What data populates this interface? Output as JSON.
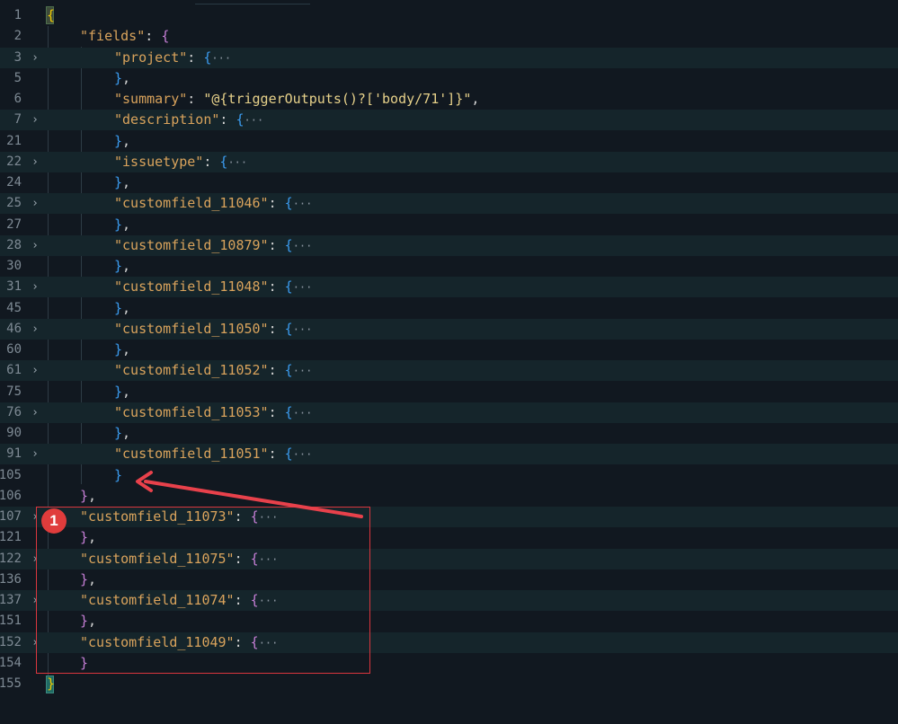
{
  "editor": {
    "lines": [
      {
        "num": "1",
        "fold": false,
        "indent": 0,
        "parts": [
          {
            "t": "{",
            "c": "brace-y"
          }
        ]
      },
      {
        "num": "2",
        "fold": false,
        "indent": 1,
        "parts": [
          {
            "t": "\"fields\"",
            "c": "key"
          },
          {
            "t": ": ",
            "c": "punc"
          },
          {
            "t": "{",
            "c": "brace-m"
          }
        ]
      },
      {
        "num": "3",
        "fold": true,
        "indent": 2,
        "parts": [
          {
            "t": "\"project\"",
            "c": "key"
          },
          {
            "t": ": ",
            "c": "punc"
          },
          {
            "t": "{",
            "c": "brace-b"
          },
          {
            "t": "···",
            "c": "ell"
          }
        ]
      },
      {
        "num": "5",
        "fold": false,
        "indent": 2,
        "parts": [
          {
            "t": "}",
            "c": "brace-b"
          },
          {
            "t": ",",
            "c": "punc"
          }
        ]
      },
      {
        "num": "6",
        "fold": false,
        "indent": 2,
        "parts": [
          {
            "t": "\"summary\"",
            "c": "key"
          },
          {
            "t": ": ",
            "c": "punc"
          },
          {
            "t": "\"@{triggerOutputs()?['body/71']}\"",
            "c": "str"
          },
          {
            "t": ",",
            "c": "punc"
          }
        ]
      },
      {
        "num": "7",
        "fold": true,
        "indent": 2,
        "parts": [
          {
            "t": "\"description\"",
            "c": "key"
          },
          {
            "t": ": ",
            "c": "punc"
          },
          {
            "t": "{",
            "c": "brace-b"
          },
          {
            "t": "···",
            "c": "ell"
          }
        ]
      },
      {
        "num": "21",
        "fold": false,
        "indent": 2,
        "parts": [
          {
            "t": "}",
            "c": "brace-b"
          },
          {
            "t": ",",
            "c": "punc"
          }
        ]
      },
      {
        "num": "22",
        "fold": true,
        "indent": 2,
        "parts": [
          {
            "t": "\"issuetype\"",
            "c": "key"
          },
          {
            "t": ": ",
            "c": "punc"
          },
          {
            "t": "{",
            "c": "brace-b"
          },
          {
            "t": "···",
            "c": "ell"
          }
        ]
      },
      {
        "num": "24",
        "fold": false,
        "indent": 2,
        "parts": [
          {
            "t": "}",
            "c": "brace-b"
          },
          {
            "t": ",",
            "c": "punc"
          }
        ]
      },
      {
        "num": "25",
        "fold": true,
        "indent": 2,
        "parts": [
          {
            "t": "\"customfield_11046\"",
            "c": "key"
          },
          {
            "t": ": ",
            "c": "punc"
          },
          {
            "t": "{",
            "c": "brace-b"
          },
          {
            "t": "···",
            "c": "ell"
          }
        ]
      },
      {
        "num": "27",
        "fold": false,
        "indent": 2,
        "parts": [
          {
            "t": "}",
            "c": "brace-b"
          },
          {
            "t": ",",
            "c": "punc"
          }
        ]
      },
      {
        "num": "28",
        "fold": true,
        "indent": 2,
        "parts": [
          {
            "t": "\"customfield_10879\"",
            "c": "key"
          },
          {
            "t": ": ",
            "c": "punc"
          },
          {
            "t": "{",
            "c": "brace-b"
          },
          {
            "t": "···",
            "c": "ell"
          }
        ]
      },
      {
        "num": "30",
        "fold": false,
        "indent": 2,
        "parts": [
          {
            "t": "}",
            "c": "brace-b"
          },
          {
            "t": ",",
            "c": "punc"
          }
        ]
      },
      {
        "num": "31",
        "fold": true,
        "indent": 2,
        "parts": [
          {
            "t": "\"customfield_11048\"",
            "c": "key"
          },
          {
            "t": ": ",
            "c": "punc"
          },
          {
            "t": "{",
            "c": "brace-b"
          },
          {
            "t": "···",
            "c": "ell"
          }
        ]
      },
      {
        "num": "45",
        "fold": false,
        "indent": 2,
        "parts": [
          {
            "t": "}",
            "c": "brace-b"
          },
          {
            "t": ",",
            "c": "punc"
          }
        ]
      },
      {
        "num": "46",
        "fold": true,
        "indent": 2,
        "parts": [
          {
            "t": "\"customfield_11050\"",
            "c": "key"
          },
          {
            "t": ": ",
            "c": "punc"
          },
          {
            "t": "{",
            "c": "brace-b"
          },
          {
            "t": "···",
            "c": "ell"
          }
        ]
      },
      {
        "num": "60",
        "fold": false,
        "indent": 2,
        "parts": [
          {
            "t": "}",
            "c": "brace-b"
          },
          {
            "t": ",",
            "c": "punc"
          }
        ]
      },
      {
        "num": "61",
        "fold": true,
        "indent": 2,
        "parts": [
          {
            "t": "\"customfield_11052\"",
            "c": "key"
          },
          {
            "t": ": ",
            "c": "punc"
          },
          {
            "t": "{",
            "c": "brace-b"
          },
          {
            "t": "···",
            "c": "ell"
          }
        ]
      },
      {
        "num": "75",
        "fold": false,
        "indent": 2,
        "parts": [
          {
            "t": "}",
            "c": "brace-b"
          },
          {
            "t": ",",
            "c": "punc"
          }
        ]
      },
      {
        "num": "76",
        "fold": true,
        "indent": 2,
        "parts": [
          {
            "t": "\"customfield_11053\"",
            "c": "key"
          },
          {
            "t": ": ",
            "c": "punc"
          },
          {
            "t": "{",
            "c": "brace-b"
          },
          {
            "t": "···",
            "c": "ell"
          }
        ]
      },
      {
        "num": "90",
        "fold": false,
        "indent": 2,
        "parts": [
          {
            "t": "}",
            "c": "brace-b"
          },
          {
            "t": ",",
            "c": "punc"
          }
        ]
      },
      {
        "num": "91",
        "fold": true,
        "indent": 2,
        "parts": [
          {
            "t": "\"customfield_11051\"",
            "c": "key"
          },
          {
            "t": ": ",
            "c": "punc"
          },
          {
            "t": "{",
            "c": "brace-b"
          },
          {
            "t": "···",
            "c": "ell"
          }
        ]
      },
      {
        "num": "105",
        "fold": false,
        "indent": 2,
        "parts": [
          {
            "t": "}",
            "c": "brace-b"
          }
        ]
      },
      {
        "num": "106",
        "fold": false,
        "indent": 1,
        "parts": [
          {
            "t": "}",
            "c": "brace-m"
          },
          {
            "t": ",",
            "c": "punc"
          }
        ]
      },
      {
        "num": "107",
        "fold": true,
        "indent": 1,
        "parts": [
          {
            "t": "\"customfield_11073\"",
            "c": "key"
          },
          {
            "t": ": ",
            "c": "punc"
          },
          {
            "t": "{",
            "c": "brace-m"
          },
          {
            "t": "···",
            "c": "ell"
          }
        ]
      },
      {
        "num": "121",
        "fold": false,
        "indent": 1,
        "parts": [
          {
            "t": "}",
            "c": "brace-m"
          },
          {
            "t": ",",
            "c": "punc"
          }
        ]
      },
      {
        "num": "122",
        "fold": true,
        "indent": 1,
        "parts": [
          {
            "t": "\"customfield_11075\"",
            "c": "key"
          },
          {
            "t": ": ",
            "c": "punc"
          },
          {
            "t": "{",
            "c": "brace-m"
          },
          {
            "t": "···",
            "c": "ell"
          }
        ]
      },
      {
        "num": "136",
        "fold": false,
        "indent": 1,
        "parts": [
          {
            "t": "}",
            "c": "brace-m"
          },
          {
            "t": ",",
            "c": "punc"
          }
        ]
      },
      {
        "num": "137",
        "fold": true,
        "indent": 1,
        "parts": [
          {
            "t": "\"customfield_11074\"",
            "c": "key"
          },
          {
            "t": ": ",
            "c": "punc"
          },
          {
            "t": "{",
            "c": "brace-m"
          },
          {
            "t": "···",
            "c": "ell"
          }
        ]
      },
      {
        "num": "151",
        "fold": false,
        "indent": 1,
        "parts": [
          {
            "t": "}",
            "c": "brace-m"
          },
          {
            "t": ",",
            "c": "punc"
          }
        ]
      },
      {
        "num": "152",
        "fold": true,
        "indent": 1,
        "parts": [
          {
            "t": "\"customfield_11049\"",
            "c": "key"
          },
          {
            "t": ": ",
            "c": "punc"
          },
          {
            "t": "{",
            "c": "brace-m"
          },
          {
            "t": "···",
            "c": "ell"
          }
        ]
      },
      {
        "num": "154",
        "fold": false,
        "indent": 1,
        "parts": [
          {
            "t": "}",
            "c": "brace-m"
          }
        ]
      },
      {
        "num": "155",
        "fold": false,
        "indent": 0,
        "parts": [
          {
            "t": "}",
            "c": "brace-y"
          }
        ]
      }
    ]
  },
  "annotation": {
    "badge_label": "1",
    "box_color": "#d9363e",
    "arrow_color": "#e8414b"
  },
  "icons": {
    "fold_chevron": "chevron-right-icon"
  }
}
